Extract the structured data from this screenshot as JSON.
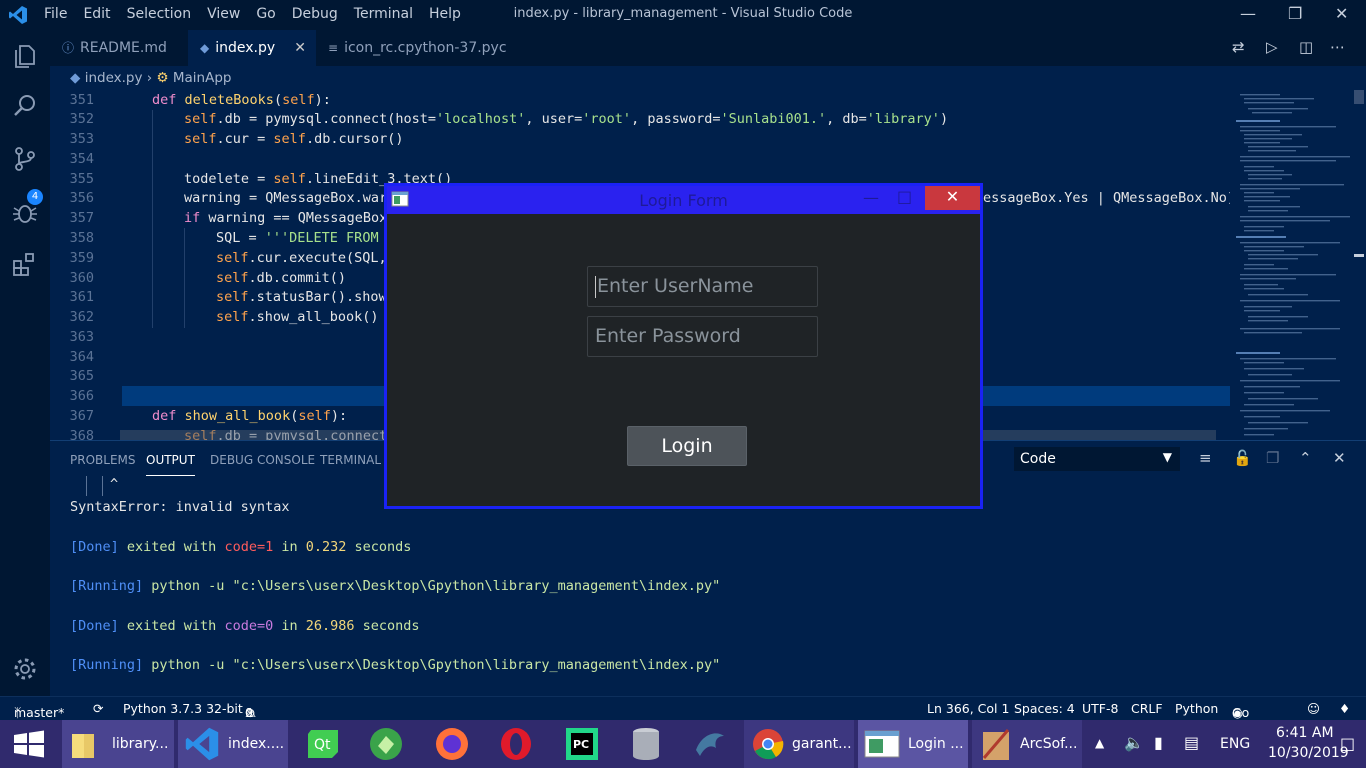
{
  "app": {
    "menu": [
      "File",
      "Edit",
      "Selection",
      "View",
      "Go",
      "Debug",
      "Terminal",
      "Help"
    ],
    "window_title": "index.py - library_management - Visual Studio Code"
  },
  "activity": {
    "badge": "4"
  },
  "tabs": [
    {
      "label": "README.md",
      "icon": "info-icon"
    },
    {
      "label": "index.py",
      "icon": "python-icon",
      "active": true
    },
    {
      "label": "icon_rc.cpython-37.pyc",
      "icon": "file-icon"
    }
  ],
  "breadcrumb": {
    "file": "index.py",
    "symbol": "MainApp"
  },
  "editor": {
    "line_numbers": [
      "351",
      "352",
      "353",
      "354",
      "355",
      "356",
      "357",
      "358",
      "359",
      "360",
      "361",
      "362",
      "363",
      "364",
      "365",
      "366",
      "367",
      "368"
    ],
    "cursor_line": "366"
  },
  "panel": {
    "tabs": [
      "PROBLEMS",
      "OUTPUT",
      "DEBUG CONSOLE",
      "TERMINAL"
    ],
    "active_tab": "OUTPUT",
    "channel": "Code",
    "output": {
      "caret": "^",
      "error": "SyntaxError: invalid syntax",
      "done1_tag": "[Done]",
      "done1_a": " exited with ",
      "done1_code": "code=1",
      "done1_b": " in ",
      "done1_time": "0.232",
      "done1_c": " seconds",
      "run1_tag": "[Running]",
      "run1_cmd": " python -u \"c:\\Users\\userx\\Desktop\\Gpython\\library_management\\index.py\"",
      "done2_tag": "[Done]",
      "done2_a": " exited with ",
      "done2_code": "code=0",
      "done2_b": " in ",
      "done2_time": "26.986",
      "done2_c": " seconds",
      "run2_tag": "[Running]",
      "run2_cmd": " python -u \"c:\\Users\\userx\\Desktop\\Gpython\\library_management\\index.py\""
    }
  },
  "status": {
    "branch": "master*",
    "python": "Python 3.7.3 32-bit",
    "errors": "0",
    "warnings": "0",
    "position": "Ln 366, Col 1",
    "spaces": "Spaces: 4",
    "encoding": "UTF-8",
    "eol": "CRLF",
    "language": "Python",
    "golive": "Go Live"
  },
  "dialog": {
    "title": "Login Form",
    "username_placeholder": "Enter UserName",
    "password_placeholder": "Enter Password",
    "login_label": "Login"
  },
  "taskbar": {
    "items": [
      "library...",
      "index....",
      "garant...",
      "Login ...",
      "ArcSof..."
    ],
    "language": "ENG",
    "time": "6:41 AM",
    "date": "10/30/2019"
  },
  "colors": {
    "accent": "#1a22f5",
    "editor_bg": "#00204b",
    "taskbar": "#302a6d",
    "close_red": "#c9383e"
  }
}
